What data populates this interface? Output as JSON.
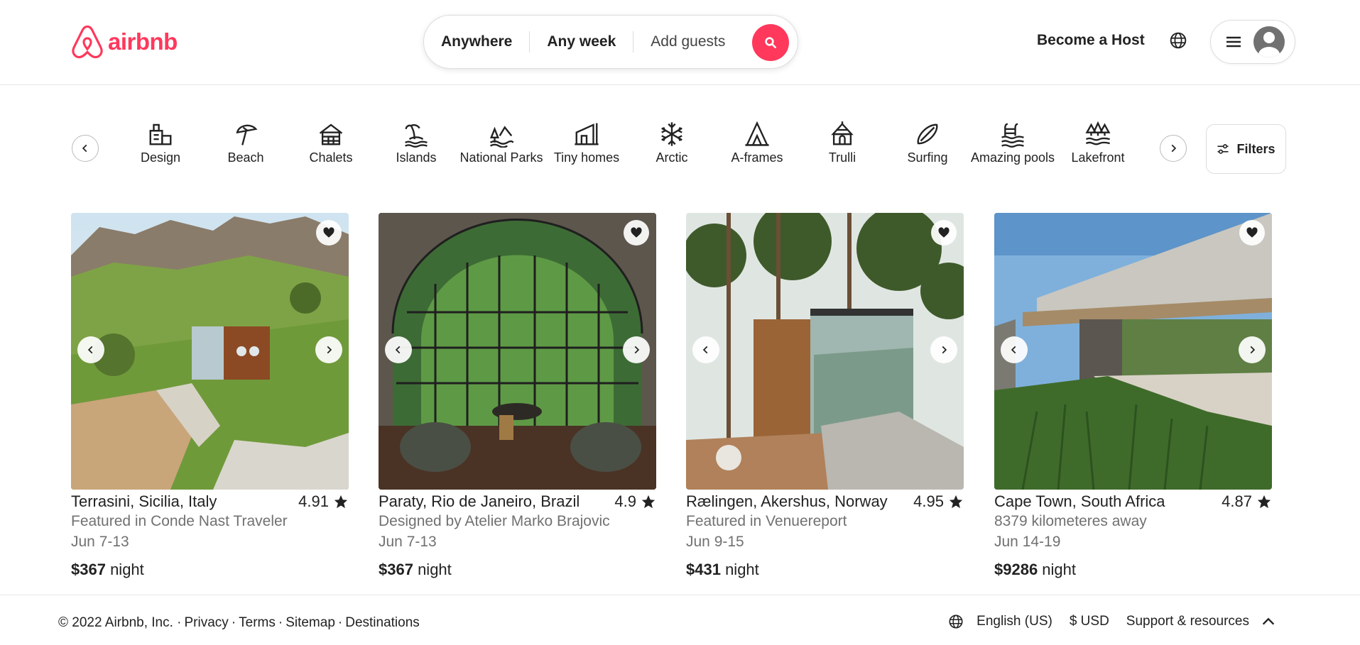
{
  "brand": {
    "name": "airbnb",
    "color": "#ff385c"
  },
  "search": {
    "anywhere": "Anywhere",
    "any_week": "Any week",
    "add_guests": "Add guests",
    "icon": "search-icon"
  },
  "header": {
    "become_host": "Become a Host",
    "globe_icon": "globe-icon",
    "menu_icon": "hamburger-icon"
  },
  "categories": [
    {
      "label": "Design",
      "icon": "design-icon"
    },
    {
      "label": "Beach",
      "icon": "beach-umbrella-icon"
    },
    {
      "label": "Chalets",
      "icon": "chalet-icon"
    },
    {
      "label": "Islands",
      "icon": "island-icon"
    },
    {
      "label": "National Parks",
      "icon": "national-park-icon"
    },
    {
      "label": "Tiny homes",
      "icon": "tiny-home-icon"
    },
    {
      "label": "Arctic",
      "icon": "snowflake-icon"
    },
    {
      "label": "A-frames",
      "icon": "a-frame-icon"
    },
    {
      "label": "Trulli",
      "icon": "trulli-icon"
    },
    {
      "label": "Surfing",
      "icon": "surfboard-icon"
    },
    {
      "label": "Amazing pools",
      "icon": "pool-icon"
    },
    {
      "label": "Lakefront",
      "icon": "lakefront-icon"
    }
  ],
  "filters": {
    "label": "Filters"
  },
  "listings": [
    {
      "location": "Terrasini, Sicilia, Italy",
      "rating": "4.91",
      "subtitle": "Featured in Conde Nast Traveler",
      "dates": "Jun 7-13",
      "price": "$367",
      "unit": " night"
    },
    {
      "location": "Paraty, Rio de Janeiro, Brazil",
      "rating": "4.9",
      "subtitle": "Designed by Atelier Marko Brajovic",
      "dates": "Jun 7-13",
      "price": "$367",
      "unit": " night"
    },
    {
      "location": "Rælingen, Akershus, Norway",
      "rating": "4.95",
      "subtitle": "Featured in Venuereport",
      "dates": "Jun 9-15",
      "price": "$431",
      "unit": " night"
    },
    {
      "location": "Cape Town, South Africa",
      "rating": "4.87",
      "subtitle": "8379 kilometeres away",
      "dates": "Jun 14-19",
      "price": "$9286",
      "unit": " night"
    }
  ],
  "footer": {
    "copyright": "© 2022 Airbnb, Inc. ·",
    "links": [
      "Privacy",
      "Terms",
      "Sitemap",
      "Destinations"
    ],
    "language": "English (US)",
    "currency": "$ USD",
    "support": "Support & resources"
  }
}
